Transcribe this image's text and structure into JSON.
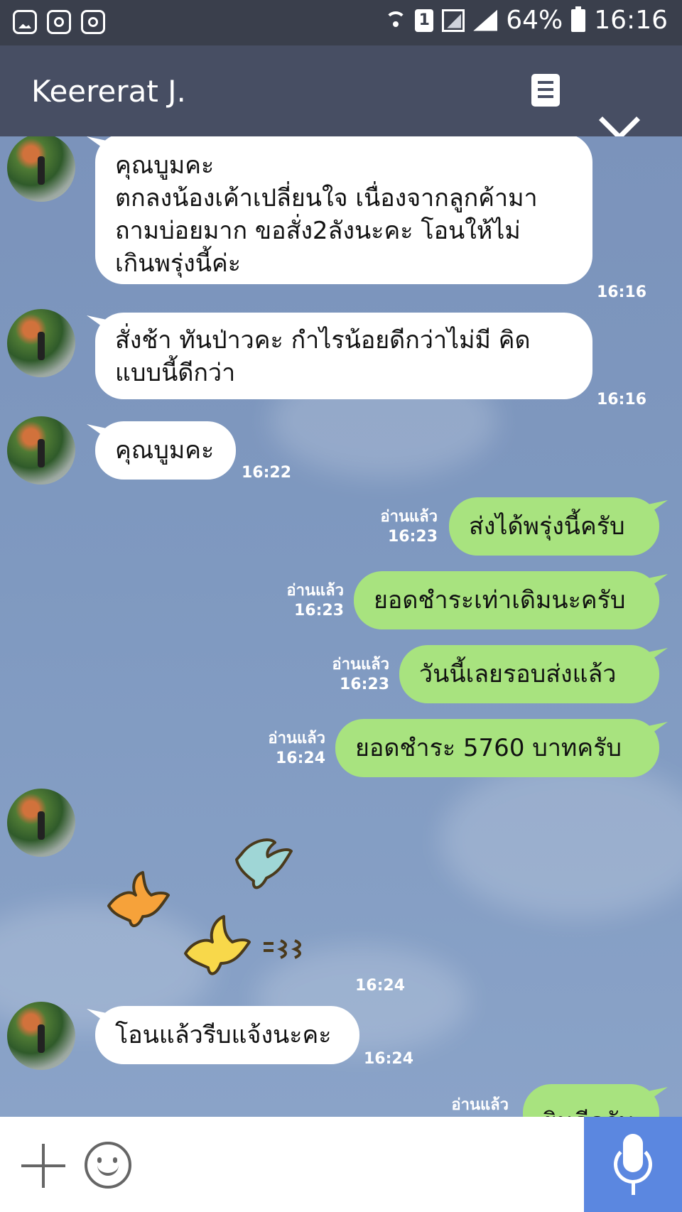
{
  "status_bar": {
    "battery": "64%",
    "time": "16:16",
    "sim_slot": "1"
  },
  "header": {
    "contact_name": "Keererat J."
  },
  "messages": [
    {
      "id": "m1",
      "direction": "in",
      "lines": [
        "คุณบูมคะ",
        "ตกลงน้องเค้าเปลี่ยนใจ เนื่องจากลูกค้ามา",
        "ถามบ่อยมาก ขอสั่ง2ลังนะคะ โอนให้ไม่",
        "เกินพรุ่งนี้ค่ะ"
      ],
      "time": "16:16"
    },
    {
      "id": "m2",
      "direction": "in",
      "lines": [
        "สั่งช้า ทันป่าวคะ กำไรน้อยดีกว่าไม่มี คิด",
        "แบบนี้ดีกว่า"
      ],
      "time": "16:16"
    },
    {
      "id": "m3",
      "direction": "in",
      "lines": [
        "คุณบูมคะ"
      ],
      "time": "16:22"
    },
    {
      "id": "m4",
      "direction": "out",
      "text": "ส่งได้พรุ่งนี้ครับ",
      "read": "อ่านแล้ว",
      "time": "16:23"
    },
    {
      "id": "m5",
      "direction": "out",
      "text": "ยอดชำระเท่าเดิมนะครับ",
      "read": "อ่านแล้ว",
      "time": "16:23"
    },
    {
      "id": "m6",
      "direction": "out",
      "text": "วันนี้เลยรอบส่งแล้ว",
      "read": "อ่านแล้ว",
      "time": "16:23"
    },
    {
      "id": "m7",
      "direction": "out",
      "text": "ยอดชำระ 5760 บาทครับ",
      "read": "อ่านแล้ว",
      "time": "16:24"
    },
    {
      "id": "m8",
      "direction": "in",
      "sticker": "flying-birds-sticker",
      "time": "16:24"
    },
    {
      "id": "m9",
      "direction": "in",
      "lines": [
        "โอนแล้วรีบแจ้งนะคะ"
      ],
      "time": "16:24"
    },
    {
      "id": "m10",
      "direction": "out",
      "text": "ยินดีครับ",
      "read": "อ่านแล้ว"
    }
  ],
  "icons": [
    "gallery-icon",
    "instagram-icon",
    "wifi-icon",
    "sim-icon",
    "signal-icon",
    "battery-icon",
    "notes-icon",
    "chevron-down-icon",
    "plus-icon",
    "emoji-icon",
    "microphone-icon"
  ],
  "colors": {
    "header": "#474e63",
    "status_bar": "#3a3f4c",
    "incoming_bubble": "#ffffff",
    "outgoing_bubble": "#a8e37f",
    "mic_button": "#5b87e0"
  }
}
